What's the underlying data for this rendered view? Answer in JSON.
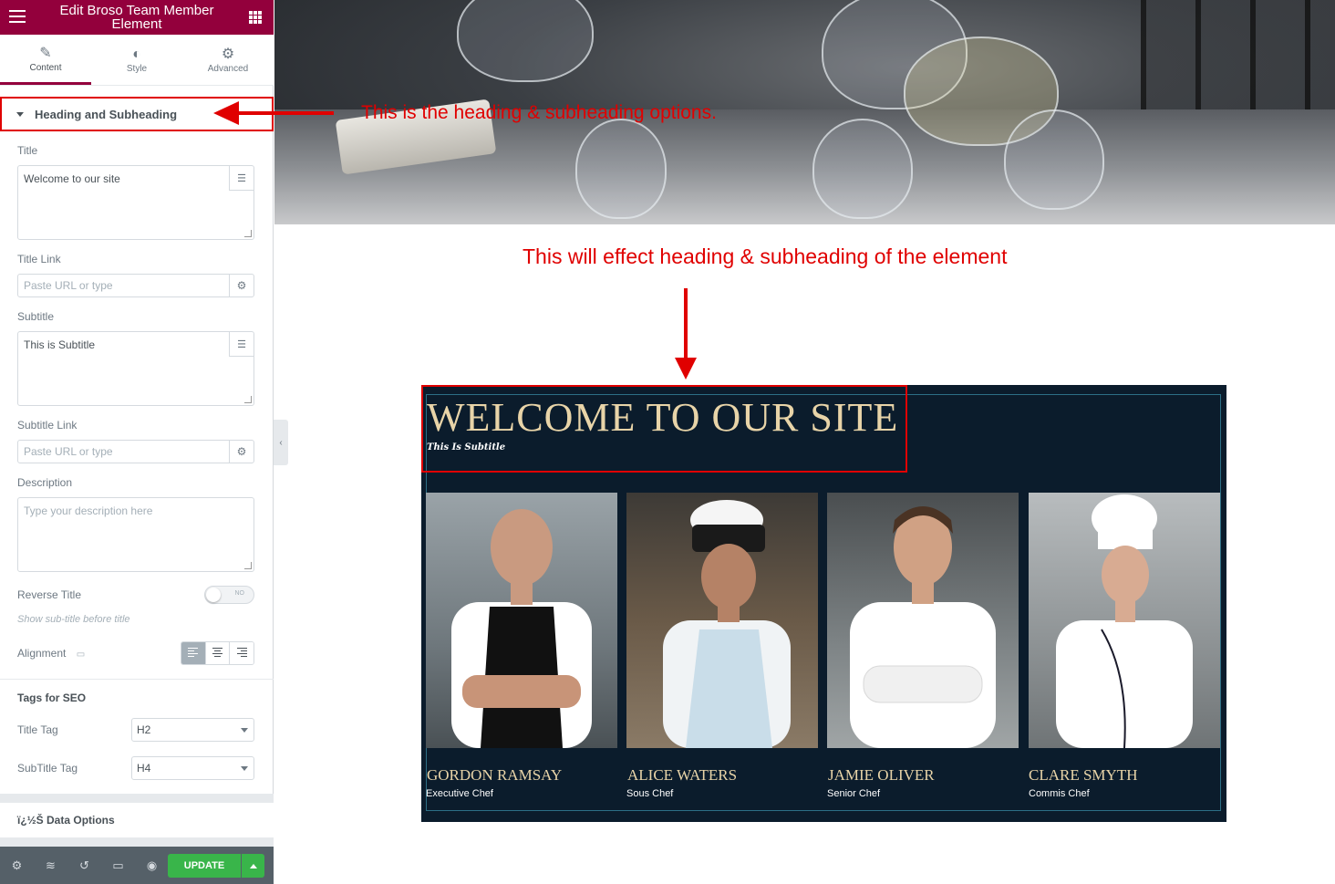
{
  "panel": {
    "title": "Edit Broso Team Member Element",
    "tabs": [
      {
        "label": "Content",
        "icon": "pencil-icon"
      },
      {
        "label": "Style",
        "icon": "half-circle-icon"
      },
      {
        "label": "Advanced",
        "icon": "gear-icon"
      }
    ],
    "section_title": "Heading and Subheading",
    "fields": {
      "title_label": "Title",
      "title_value": "Welcome to our site",
      "title_link_label": "Title Link",
      "title_link_placeholder": "Paste URL or type",
      "subtitle_label": "Subtitle",
      "subtitle_value": "This is Subtitle",
      "subtitle_link_label": "Subtitle Link",
      "subtitle_link_placeholder": "Paste URL or type",
      "description_label": "Description",
      "description_placeholder": "Type your description here",
      "reverse_title_label": "Reverse Title",
      "reverse_title_state": "NO",
      "reverse_title_hint": "Show sub-title before title",
      "alignment_label": "Alignment"
    },
    "seo": {
      "heading": "Tags for SEO",
      "title_tag_label": "Title Tag",
      "title_tag_value": "H2",
      "subtitle_tag_label": "SubTitle Tag",
      "subtitle_tag_value": "H4"
    },
    "data_options_label": "ï¿½Š Data Options",
    "update_label": "UPDATE"
  },
  "annotations": {
    "top": "This is the heading & subheading options.",
    "middle": "This will effect heading & subheading of the element"
  },
  "preview": {
    "heading": "WELCOME TO OUR SITE",
    "subtitle": "This Is Subtitle",
    "members": [
      {
        "name": "GORDON RAMSAY",
        "role": "Executive Chef"
      },
      {
        "name": "ALICE WATERS",
        "role": "Sous Chef"
      },
      {
        "name": "JAMIE OLIVER",
        "role": "Senior Chef"
      },
      {
        "name": "CLARE SMYTH",
        "role": "Commis Chef"
      }
    ]
  },
  "colors": {
    "brand": "#93003c",
    "annotation": "#e00000",
    "update": "#39b54a",
    "team_bg": "#0b1c2c",
    "gold": "#e8d4a8"
  }
}
